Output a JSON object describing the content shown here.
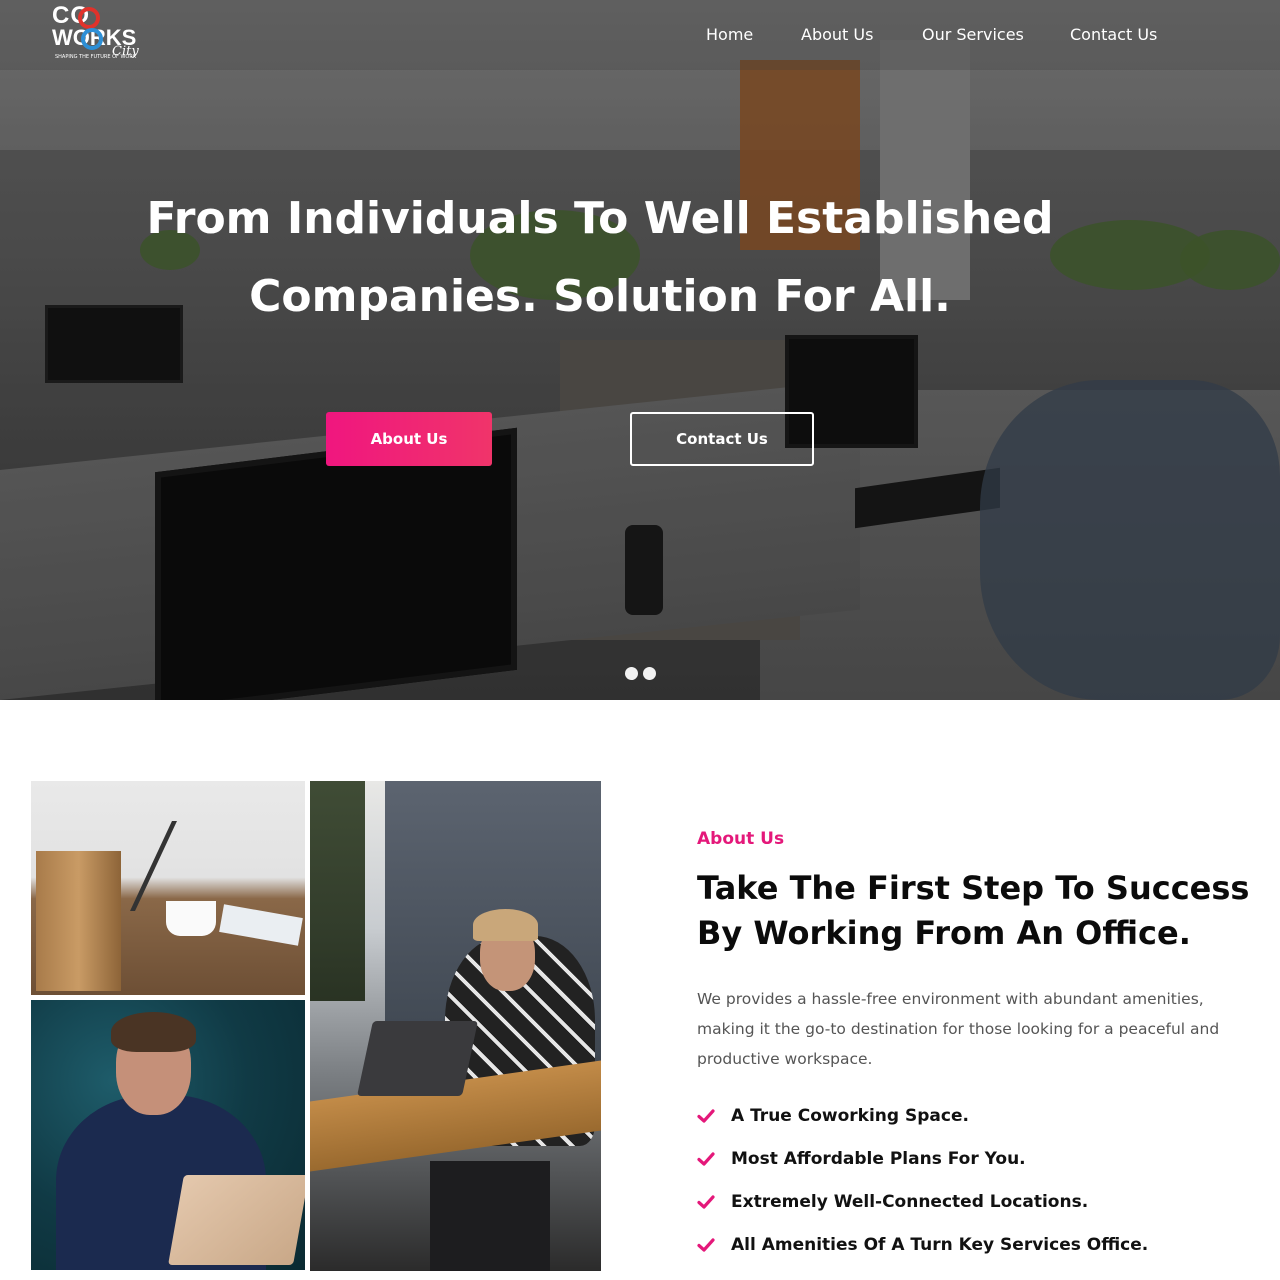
{
  "brand": {
    "logo_line1": "CO",
    "logo_line2": "WORKS",
    "logo_script": "City",
    "logo_tagline": "SHAPING THE FUTURE OF WORK",
    "accent_color": "#e4187a",
    "logo_red": "#e0322b",
    "logo_blue": "#2d8fd6"
  },
  "nav": {
    "items": [
      {
        "label": "Home"
      },
      {
        "label": "About Us"
      },
      {
        "label": "Our Services"
      },
      {
        "label": "Contact Us"
      }
    ]
  },
  "hero": {
    "title": "From Individuals To Well Established Companies. Solution For All.",
    "primary_button": "About Us",
    "secondary_button": "Contact Us",
    "slides_count": 2,
    "active_slide": 1
  },
  "about": {
    "label": "About Us",
    "title": "Take The First Step To Success By Working From An Office.",
    "text": "We provides a hassle-free environment with abundant amenities, making it the go-to destination for those looking for a peaceful and productive workspace.",
    "features": [
      {
        "text": "A True Coworking Space.",
        "icon": "check-icon"
      },
      {
        "text": "Most Affordable Plans For You.",
        "icon": "check-icon"
      },
      {
        "text": "Extremely Well-Connected Locations.",
        "icon": "check-icon"
      },
      {
        "text": "All Amenities Of A Turn Key Services Office.",
        "icon": "check-icon"
      }
    ]
  }
}
